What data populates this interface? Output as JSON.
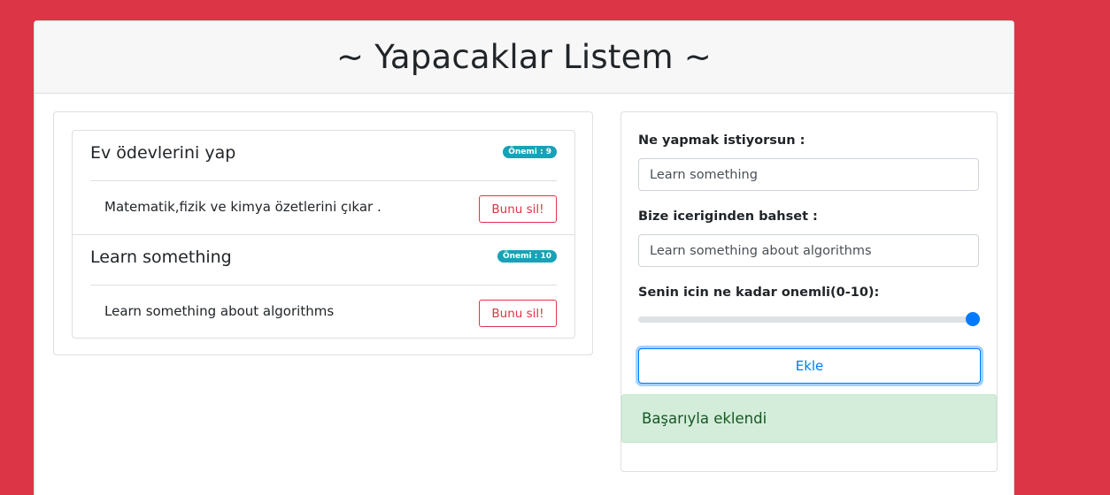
{
  "header": {
    "title": "~ Yapacaklar Listem ~"
  },
  "todos": [
    {
      "title": "Ev ödevlerini yap",
      "badge": "Önemi : 9",
      "description": "Matematik,fizik ve kimya özetlerini çıkar .",
      "delete_label": "Bunu sil!"
    },
    {
      "title": "Learn something",
      "badge": "Önemi : 10",
      "description": "Learn something about algorithms",
      "delete_label": "Bunu sil!"
    }
  ],
  "form": {
    "what_label": "Ne yapmak istiyorsun :",
    "what_value": "Learn something",
    "about_label": "Bize iceriginden bahset :",
    "about_value": "Learn something about algorithms",
    "importance_label": "Senin icin ne kadar onemli(0-10):",
    "importance_value": 10,
    "importance_min": 0,
    "importance_max": 10,
    "add_label": "Ekle",
    "success_message": "Başarıyla eklendi"
  },
  "colors": {
    "background": "#dc3545",
    "badge": "#17a2b8",
    "primary": "#007bff",
    "danger": "#dc3545",
    "success_bg": "#d4edda",
    "success_text": "#155724"
  }
}
